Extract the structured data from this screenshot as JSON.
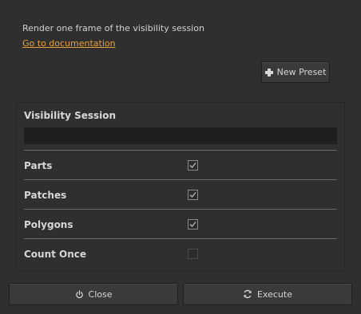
{
  "header": {
    "description": "Render one frame of the visibility session",
    "doc_link": "Go to documentation"
  },
  "toolbar": {
    "new_preset_label": "New Preset",
    "new_preset_icon": "plus-icon"
  },
  "session": {
    "title": "Visibility Session",
    "value": "",
    "rows": [
      {
        "label": "Parts",
        "checked": true
      },
      {
        "label": "Patches",
        "checked": true
      },
      {
        "label": "Polygons",
        "checked": true
      },
      {
        "label": "Count Once",
        "checked": false
      }
    ]
  },
  "footer": {
    "close_label": "Close",
    "close_icon": "power-icon",
    "execute_label": "Execute",
    "execute_icon": "refresh-icon"
  },
  "colors": {
    "background": "#2f2f2f",
    "link": "#e8a23b",
    "input_bg": "#1f1f1f"
  }
}
